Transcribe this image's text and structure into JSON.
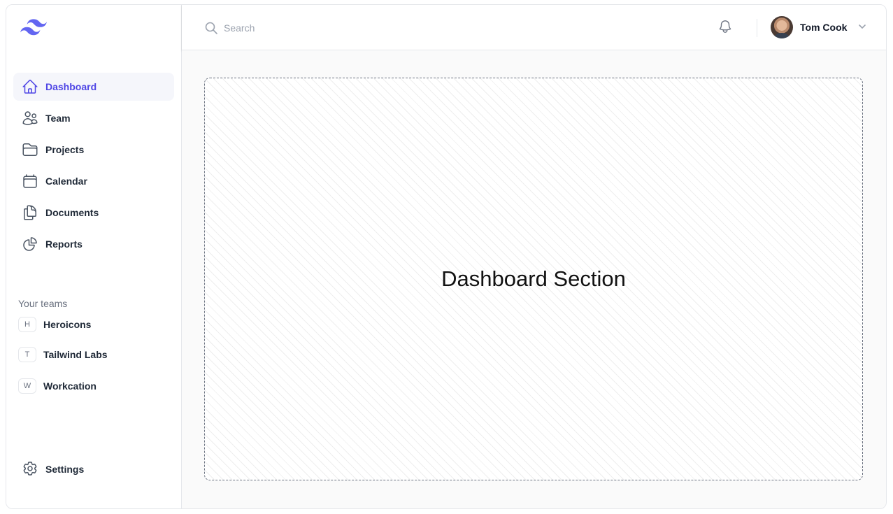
{
  "colors": {
    "accent": "#4f46e5",
    "active_bg": "#f5f6fb",
    "text": "#1f2937",
    "muted": "#6b7280"
  },
  "logo": {
    "icon": "tailwind-logo-icon"
  },
  "sidebar": {
    "nav": [
      {
        "label": "Dashboard",
        "icon": "home-icon",
        "active": true
      },
      {
        "label": "Team",
        "icon": "users-icon",
        "active": false
      },
      {
        "label": "Projects",
        "icon": "folder-icon",
        "active": false
      },
      {
        "label": "Calendar",
        "icon": "calendar-icon",
        "active": false
      },
      {
        "label": "Documents",
        "icon": "documents-icon",
        "active": false
      },
      {
        "label": "Reports",
        "icon": "chart-pie-icon",
        "active": false
      }
    ],
    "teams_heading": "Your teams",
    "teams": [
      {
        "initial": "H",
        "name": "Heroicons"
      },
      {
        "initial": "T",
        "name": "Tailwind Labs"
      },
      {
        "initial": "W",
        "name": "Workcation"
      }
    ],
    "settings": {
      "label": "Settings",
      "icon": "gear-icon"
    }
  },
  "header": {
    "search": {
      "placeholder": "Search",
      "value": ""
    },
    "notifications_icon": "bell-icon",
    "user": {
      "name": "Tom Cook"
    }
  },
  "main": {
    "title": "Dashboard Section"
  }
}
